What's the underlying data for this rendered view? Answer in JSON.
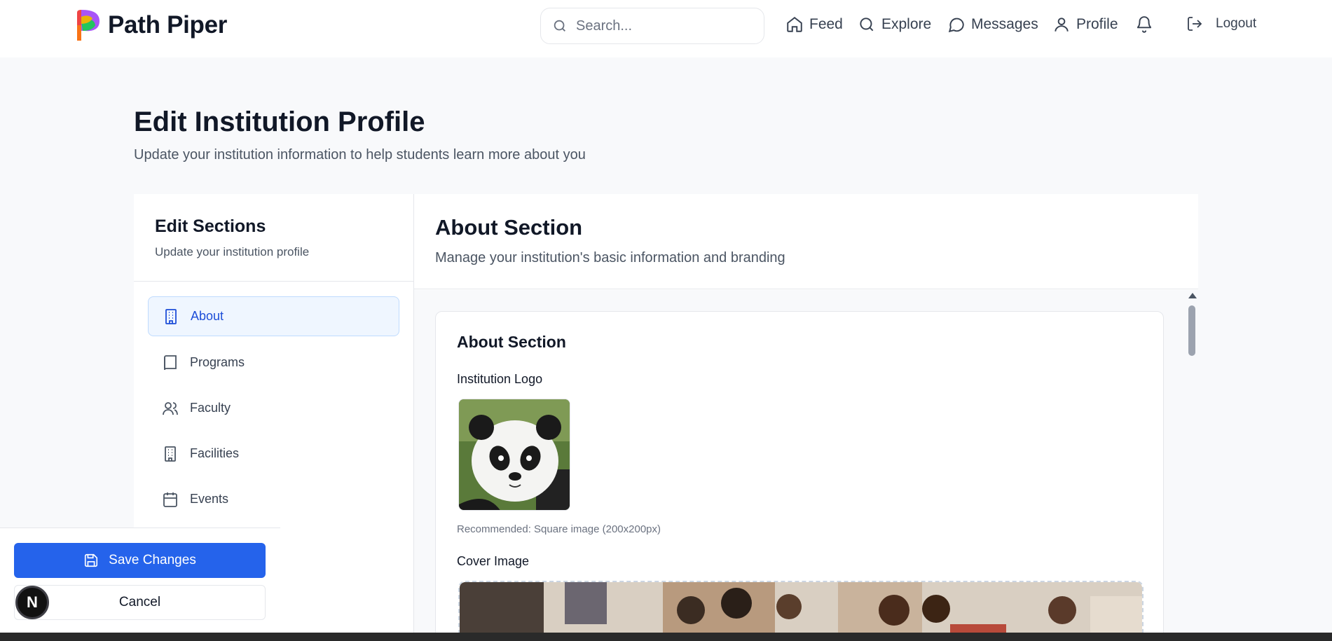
{
  "app": {
    "brand_name": "Path Piper"
  },
  "header": {
    "search_placeholder": "Search...",
    "nav": [
      {
        "label": "Feed",
        "icon": "home-icon"
      },
      {
        "label": "Explore",
        "icon": "search-icon"
      },
      {
        "label": "Messages",
        "icon": "message-circle-icon"
      },
      {
        "label": "Profile",
        "icon": "user-icon"
      }
    ],
    "logout_label": "Logout"
  },
  "page": {
    "title": "Edit Institution Profile",
    "subtitle": "Update your institution information to help students learn more about you"
  },
  "sidebar": {
    "title": "Edit Sections",
    "subtitle": "Update your institution profile",
    "items": [
      {
        "label": "About",
        "icon": "building-icon",
        "active": true
      },
      {
        "label": "Programs",
        "icon": "book-icon"
      },
      {
        "label": "Faculty",
        "icon": "users-icon"
      },
      {
        "label": "Facilities",
        "icon": "building-icon"
      },
      {
        "label": "Events",
        "icon": "calendar-icon"
      }
    ]
  },
  "panel": {
    "title": "About Section",
    "subtitle": "Manage your institution's basic information and branding",
    "card": {
      "title": "About Section",
      "logo_label": "Institution Logo",
      "logo_hint": "Recommended: Square image (200x200px)",
      "cover_label": "Cover Image"
    }
  },
  "actions": {
    "save_label": "Save Changes",
    "cancel_label": "Cancel",
    "badge_letter": "N"
  },
  "colors": {
    "accent": "#2563eb",
    "active_bg": "#eff6ff"
  }
}
